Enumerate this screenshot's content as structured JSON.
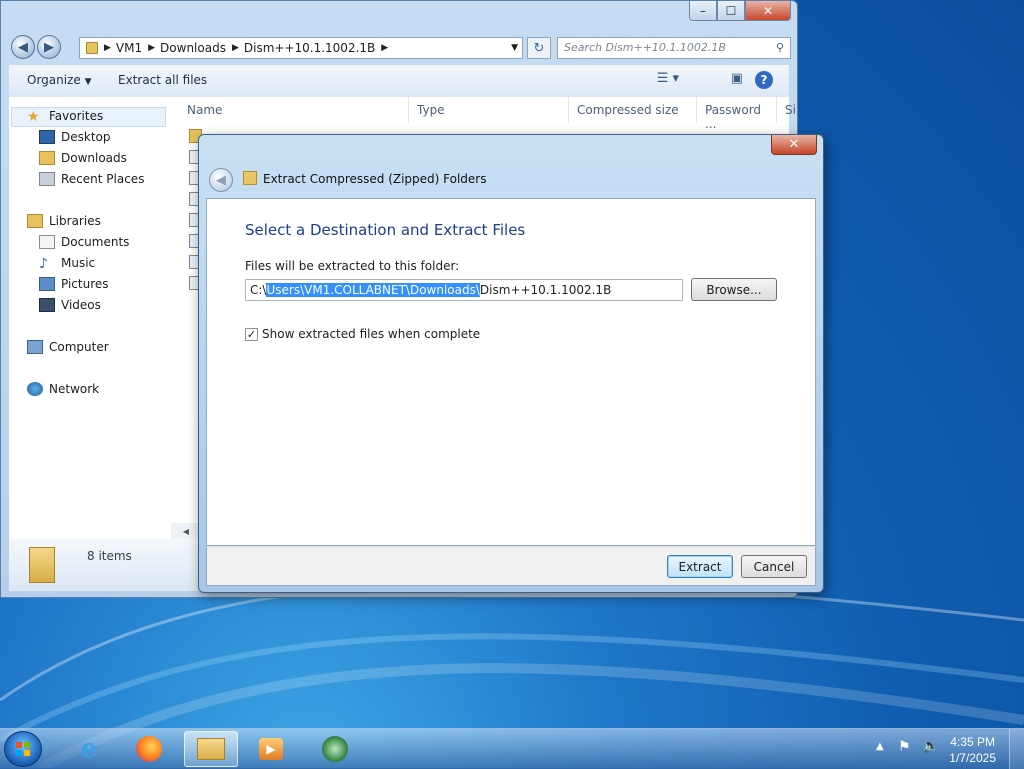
{
  "explorer": {
    "breadcrumb": [
      "VM1",
      "Downloads",
      "Dism++10.1.1002.1B"
    ],
    "search_placeholder": "Search Dism++10.1.1002.1B",
    "toolbar": {
      "organize": "Organize",
      "extract_all": "Extract all files"
    },
    "columns": [
      "Name",
      "Type",
      "Compressed size",
      "Password ...",
      "Si"
    ],
    "nav": {
      "favorites": "Favorites",
      "desktop": "Desktop",
      "downloads": "Downloads",
      "recent": "Recent Places",
      "libraries": "Libraries",
      "documents": "Documents",
      "music": "Music",
      "pictures": "Pictures",
      "videos": "Videos",
      "computer": "Computer",
      "network": "Network"
    },
    "status": {
      "count": "8 items"
    }
  },
  "dialog": {
    "title": "Extract Compressed (Zipped) Folders",
    "heading": "Select a Destination and Extract Files",
    "label": "Files will be extracted to this folder:",
    "path": {
      "prefix": "C:\\",
      "selected": "Users\\VM1.COLLABNET\\Downloads\\",
      "suffix": "Dism++10.1.1002.1B"
    },
    "browse": "Browse...",
    "checkbox_label": "Show extracted files when complete",
    "checkbox_checked": true,
    "extract": "Extract",
    "cancel": "Cancel",
    "close_glyph": "✕"
  },
  "taskbar": {
    "time": "4:35 PM",
    "date": "1/7/2025"
  },
  "icons": {
    "caption_min": "–",
    "caption_max": "☐",
    "caption_close": "✕",
    "back": "◀",
    "forward": "▶",
    "refresh": "↻",
    "search": "⚲",
    "help": "?"
  },
  "colors": {
    "accent": "#3390ff",
    "heading": "#1b3f8b"
  }
}
